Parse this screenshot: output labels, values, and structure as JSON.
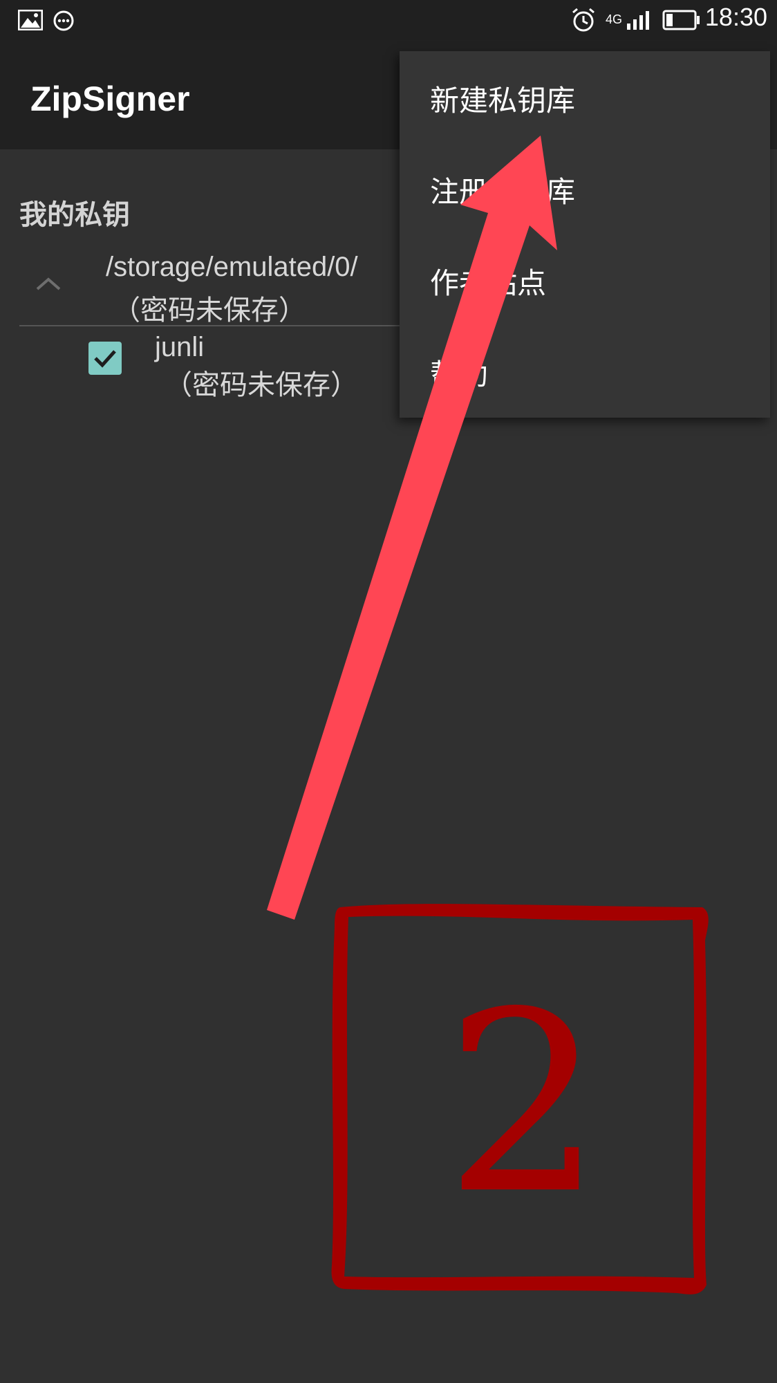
{
  "status_bar": {
    "time": "18:30",
    "network": "4G",
    "icons": [
      "image-icon",
      "more-dots-icon",
      "alarm-icon",
      "signal-icon",
      "battery-icon"
    ]
  },
  "app_bar": {
    "title": "ZipSigner"
  },
  "keys_section": {
    "header": "我的私钥",
    "keystore": {
      "path": "/storage/emulated/0/",
      "status": "（密码未保存）",
      "expanded": true
    },
    "keys": [
      {
        "alias": "junli",
        "status": "（密码未保存）",
        "checked": true
      }
    ]
  },
  "overflow_menu": {
    "items": [
      {
        "label": "新建私钥库"
      },
      {
        "label": "注册私钥库"
      },
      {
        "label": "作者站点"
      },
      {
        "label": "帮助"
      }
    ]
  },
  "annotation": {
    "step_number": "2",
    "arrow_color": "#ff4654",
    "stamp_color": "#a40000"
  }
}
